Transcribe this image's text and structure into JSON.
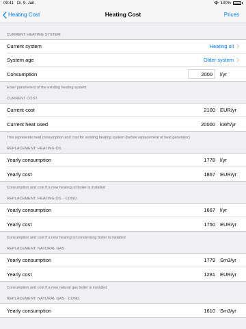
{
  "status": {
    "time": "09:41",
    "date": "Di. 9. Jan.",
    "battery": "100%"
  },
  "nav": {
    "back_label": "Heating Cost",
    "title": "Heating Cost",
    "right_label": "Prices"
  },
  "current_system": {
    "header": "Current Heating System",
    "rows": [
      {
        "label": "Current system",
        "value": "Heating oil"
      },
      {
        "label": "System age",
        "value": "Older system"
      }
    ],
    "consumption": {
      "label": "Consumption",
      "value": "2000",
      "unit": "l/yr"
    },
    "footer": "Enter parameters of the existing heating system"
  },
  "current_cost": {
    "header": "Current Cost",
    "rows": [
      {
        "label": "Current cost",
        "value": "2100",
        "unit": "EUR/yr"
      },
      {
        "label": "Current heat used",
        "value": "20000",
        "unit": "kWh/yr"
      }
    ],
    "footer": "This represents heat consumption and cost for existing heating system (before replacement of heat generator)"
  },
  "oil": {
    "header": "Replacement: Heating Oil",
    "rows": [
      {
        "label": "Yearly consumption",
        "value": "1778",
        "unit": "l/yr"
      },
      {
        "label": "Yearly cost",
        "value": "1867",
        "unit": "EUR/yr"
      }
    ],
    "footer": "Consumption and cost if a new heating oil boiler is installed"
  },
  "oil_cond": {
    "header": "Replacement: Heating Oil - Cond.",
    "rows": [
      {
        "label": "Yearly consumption",
        "value": "1667",
        "unit": "l/yr"
      },
      {
        "label": "Yearly cost",
        "value": "1750",
        "unit": "EUR/yr"
      }
    ],
    "footer": "Consumption and cost if a new heating oil condensing boiler is installed"
  },
  "gas": {
    "header": "Replacement: Natural Gas",
    "rows": [
      {
        "label": "Yearly consumption",
        "value": "1779",
        "unit": "Sm3/yr"
      },
      {
        "label": "Yearly cost",
        "value": "1281",
        "unit": "EUR/yr"
      }
    ],
    "footer": "Consumption and cost if a new natural gas boiler is installed"
  },
  "gas_cond": {
    "header": "Replacement: Natural Gas - Cond.",
    "rows": [
      {
        "label": "Yearly consumption",
        "value": "1610",
        "unit": "Sm3/yr"
      }
    ]
  }
}
